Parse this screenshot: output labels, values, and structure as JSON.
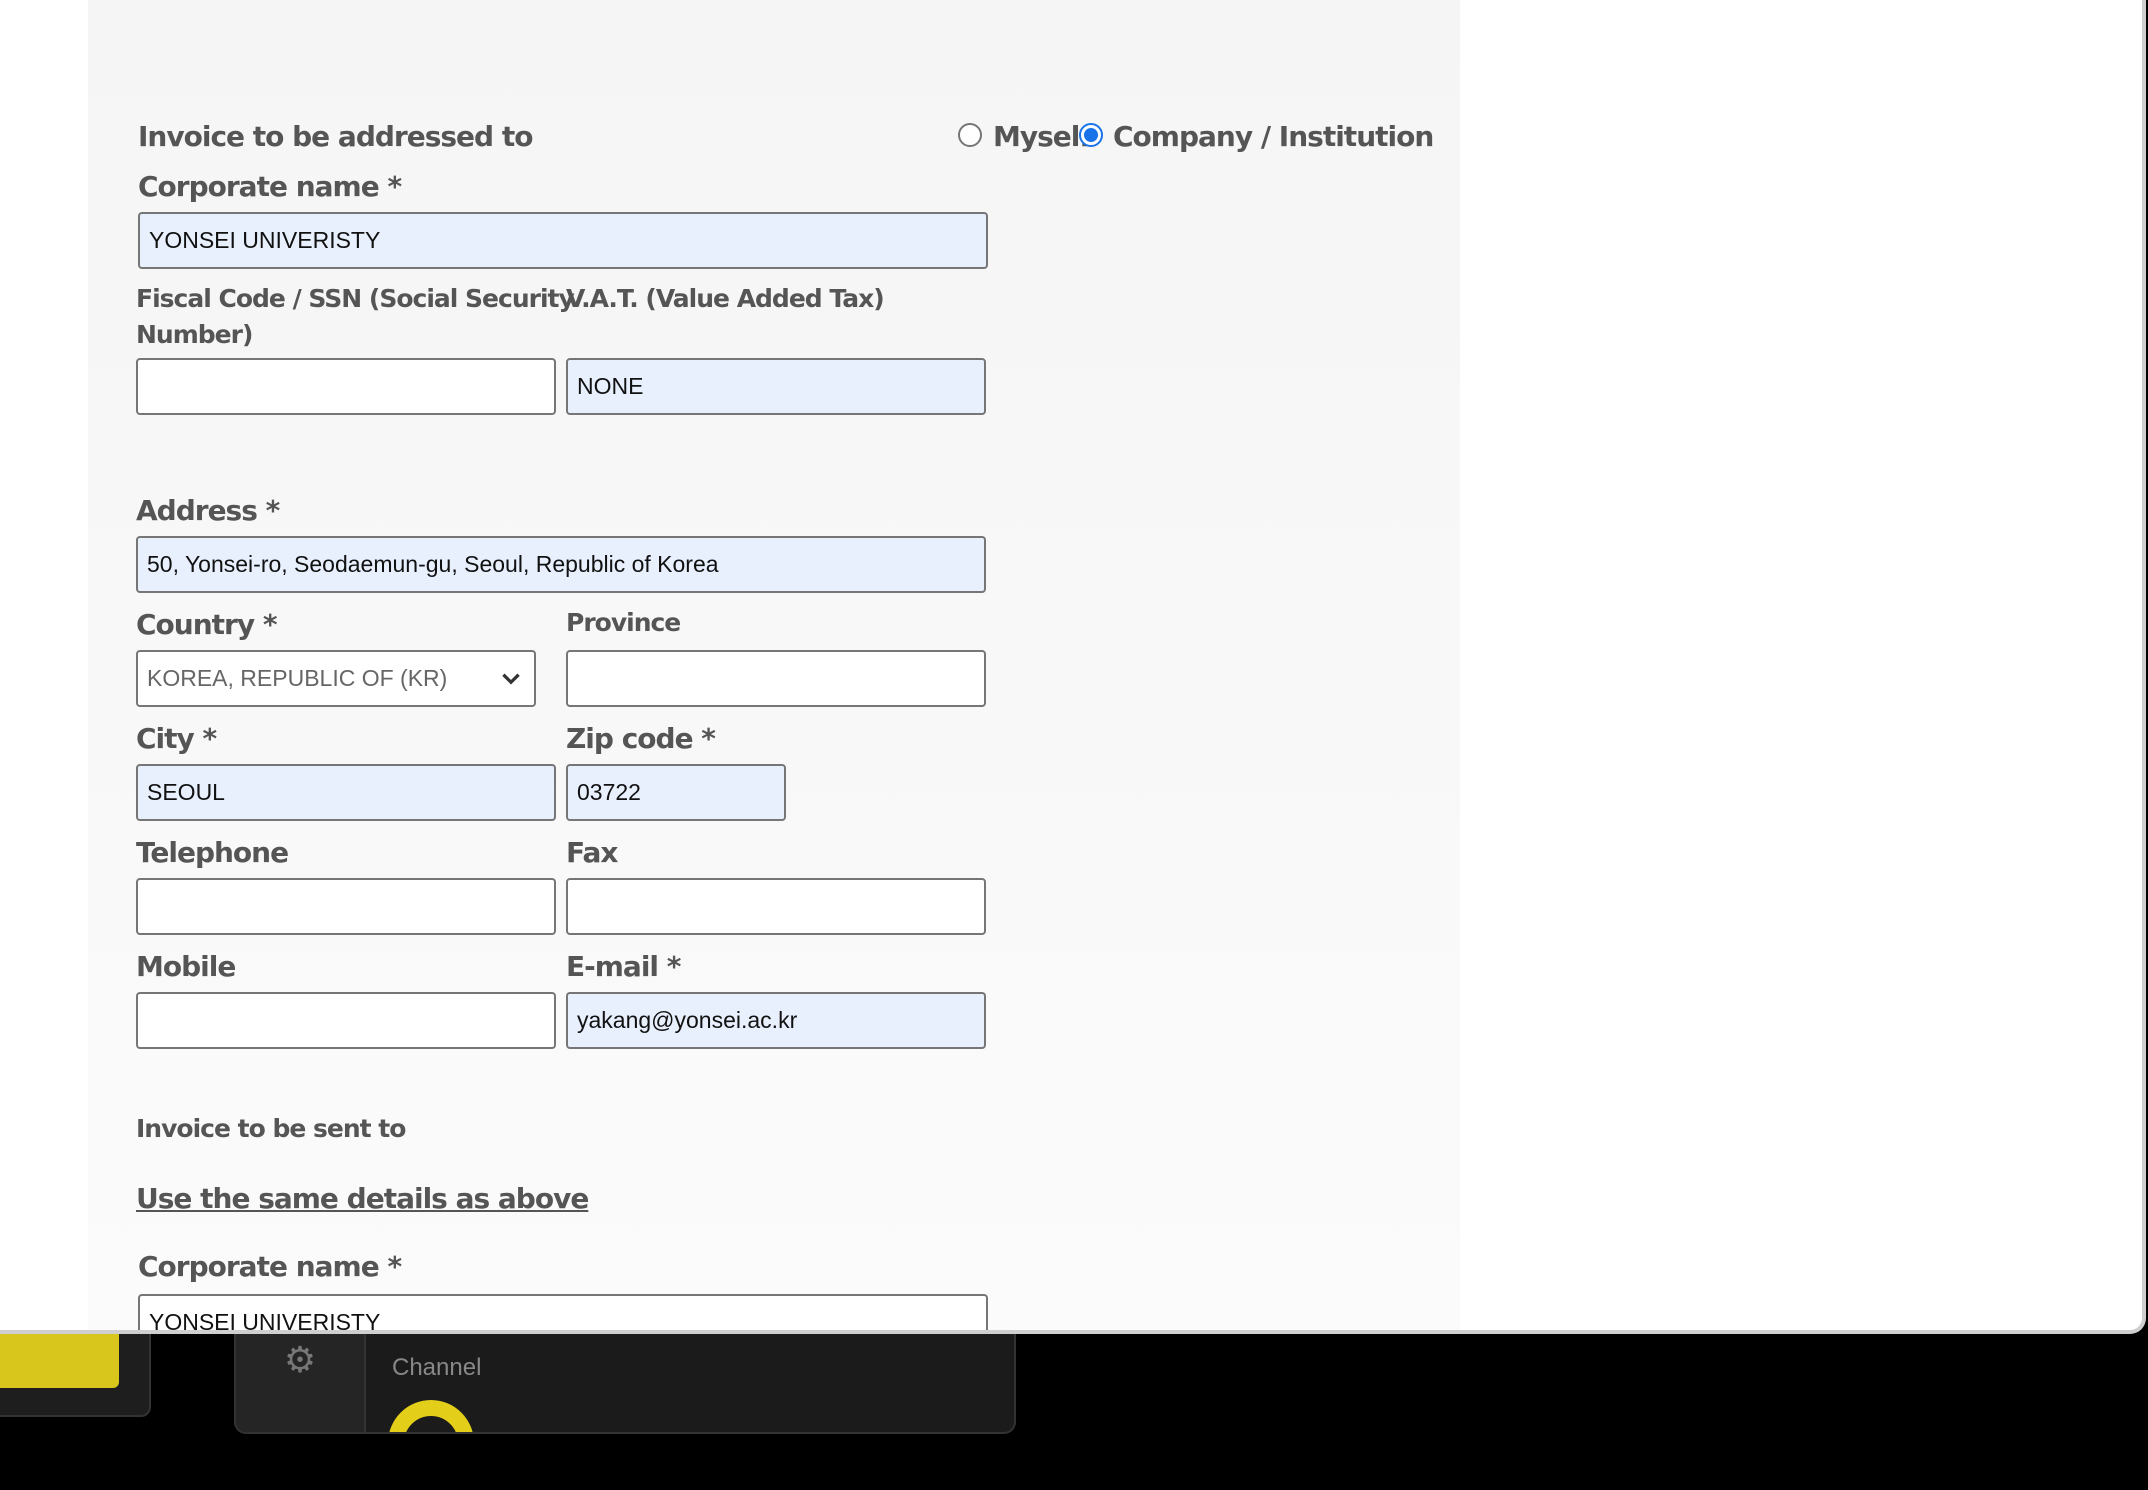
{
  "background": {
    "channel_label": "Channel"
  },
  "invoice_to": {
    "heading": "Invoice to be addressed to",
    "options": [
      {
        "label": "Myself",
        "selected": false
      },
      {
        "label": "Company / Institution",
        "selected": true
      }
    ]
  },
  "corporate_name": {
    "label": "Corporate name *",
    "value": "YONSEI UNIVERISTY"
  },
  "fiscal_code": {
    "label_line1": "Fiscal Code / SSN (Social Security",
    "label_line2": "Number)",
    "value": ""
  },
  "vat": {
    "label": "V.A.T. (Value Added Tax)",
    "value": "NONE"
  },
  "address": {
    "label": "Address *",
    "value": "50, Yonsei-ro, Seodaemun-gu, Seoul, Republic of Korea"
  },
  "country": {
    "label": "Country *",
    "value": "KOREA, REPUBLIC OF (KR)"
  },
  "province": {
    "label": "Province",
    "value": ""
  },
  "city": {
    "label": "City *",
    "value": "SEOUL"
  },
  "zip": {
    "label": "Zip code *",
    "value": "03722"
  },
  "telephone": {
    "label": "Telephone",
    "value": ""
  },
  "fax": {
    "label": "Fax",
    "value": ""
  },
  "mobile": {
    "label": "Mobile",
    "value": ""
  },
  "email": {
    "label": "E-mail *",
    "value": "yakang@yonsei.ac.kr"
  },
  "sent_to": {
    "heading": "Invoice to be sent to",
    "same_details_link": "Use the same details as above",
    "corporate_label": "Corporate name *",
    "corporate_value": "YONSEI UNIVERISTY"
  },
  "colors": {
    "accent": "#1a73e8",
    "autofill": "#e8f0fe",
    "label": "#555555",
    "brand_yellow": "#e3ce1a"
  }
}
